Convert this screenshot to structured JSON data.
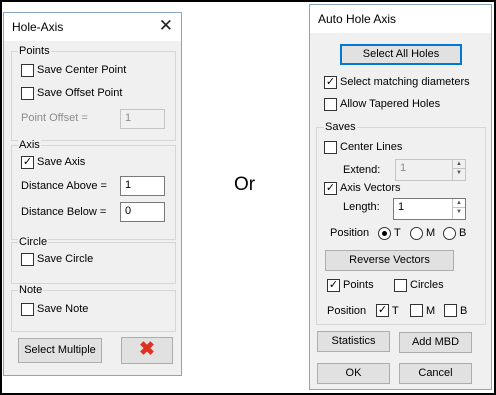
{
  "left": {
    "title": "Hole-Axis",
    "close_icon": "close-icon",
    "points": {
      "label": "Points",
      "save_center": "Save Center Point",
      "save_offset": "Save Offset Point",
      "offset_label": "Point Offset =",
      "offset_value": "1"
    },
    "axis": {
      "label": "Axis",
      "save_axis": "Save Axis",
      "save_axis_checked": "✓",
      "dist_above_label": "Distance Above =",
      "dist_above_value": "1",
      "dist_below_label": "Distance Below =",
      "dist_below_value": "0"
    },
    "circle": {
      "label": "Circle",
      "save_circle": "Save Circle"
    },
    "note": {
      "label": "Note",
      "save_note": "Save Note"
    },
    "buttons": {
      "select_multiple": "Select Multiple",
      "cancel_icon": "red-x-icon",
      "cancel_glyph": "✖",
      "cancel_color": "#e0301e"
    }
  },
  "or_text": "Or",
  "right": {
    "title": "Auto Hole Axis",
    "select_all": "Select All Holes",
    "select_matching": "Select matching diameters",
    "select_matching_checked": "✓",
    "allow_tapered": "Allow Tapered Holes",
    "saves": {
      "label": "Saves",
      "center_lines": "Center Lines",
      "extend_label": "Extend:",
      "extend_value": "1",
      "axis_vectors": "Axis Vectors",
      "axis_vectors_checked": "✓",
      "length_label": "Length:",
      "length_value": "1",
      "position_label": "Position",
      "radio_t": "T",
      "radio_m": "M",
      "radio_b": "B",
      "reverse_vectors": "Reverse Vectors",
      "points": "Points",
      "points_checked": "✓",
      "circles": "Circles",
      "position2_label": "Position",
      "pos_t": "T",
      "pos_t_checked": "✓",
      "pos_m": "M",
      "pos_b": "B"
    },
    "statistics": "Statistics",
    "add_mbd": "Add MBD",
    "ok": "OK",
    "cancel": "Cancel"
  },
  "spin_up_glyph": "▲",
  "spin_dn_glyph": "▼"
}
